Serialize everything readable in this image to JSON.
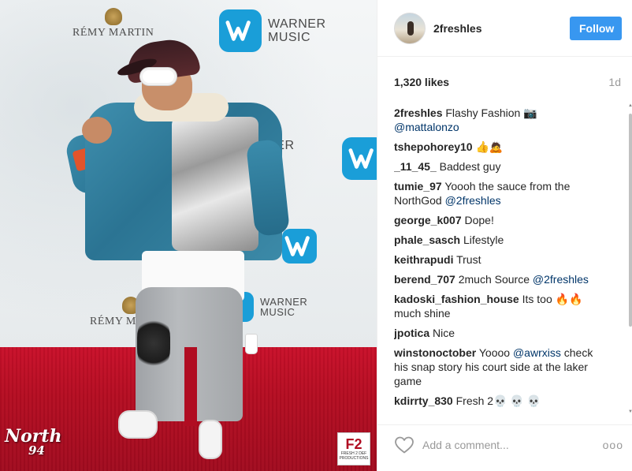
{
  "photo": {
    "backdrop_logos": [
      {
        "brand": "RÉMY MARTIN"
      },
      {
        "brand": "WARNER\nMUSIC"
      }
    ],
    "watermark_left": {
      "line1": "North",
      "line2": "94"
    },
    "watermark_right": {
      "big": "F2",
      "small": "FRESH 2 DEF\nPRODUCTIONS"
    }
  },
  "header": {
    "username": "2freshles",
    "follow_label": "Follow"
  },
  "stats": {
    "likes": "1,320 likes",
    "age": "1d"
  },
  "comments": [
    {
      "user": "2freshles",
      "text": "Flashy Fashion 📷",
      "mention": "@mattalonzo"
    },
    {
      "user": "tshepohorey10",
      "text": "👍🙇",
      "mention": ""
    },
    {
      "user": "_11_45_",
      "text": "Baddest guy",
      "mention": ""
    },
    {
      "user": "tumie_97",
      "text": "Yoooh the sauce from the NorthGod",
      "mention": "@2freshles"
    },
    {
      "user": "george_k007",
      "text": "Dope!",
      "mention": ""
    },
    {
      "user": "phale_sasch",
      "text": "Lifestyle",
      "mention": ""
    },
    {
      "user": "keithrapudi",
      "text": "Trust",
      "mention": ""
    },
    {
      "user": "berend_707",
      "text": "2much Source",
      "mention": "@2freshles"
    },
    {
      "user": "kadoski_fashion_house",
      "text": "Its too 🔥🔥 much shine",
      "mention": ""
    },
    {
      "user": "jpotica",
      "text": "Nice",
      "mention": ""
    },
    {
      "user": "winstonoctober",
      "text": "Yoooo",
      "mention": "@awrxiss",
      "text_after": "check his snap story his court side at the laker game"
    },
    {
      "user": "kdirrty_830",
      "text": "Fresh 2💀 💀 💀",
      "mention": ""
    },
    {
      "user": "",
      "text": "",
      "mention": ""
    }
  ],
  "footer": {
    "comment_placeholder": "Add a comment...",
    "more_label": "ooo"
  },
  "colors": {
    "follow_button": "#3897f0",
    "mention": "#003569",
    "muted": "#999999",
    "carpet": "#c9102a",
    "warner_badge": "#1a9ed8"
  },
  "icons": {
    "heart": "heart-outline-icon",
    "more": "more-options-icon"
  }
}
